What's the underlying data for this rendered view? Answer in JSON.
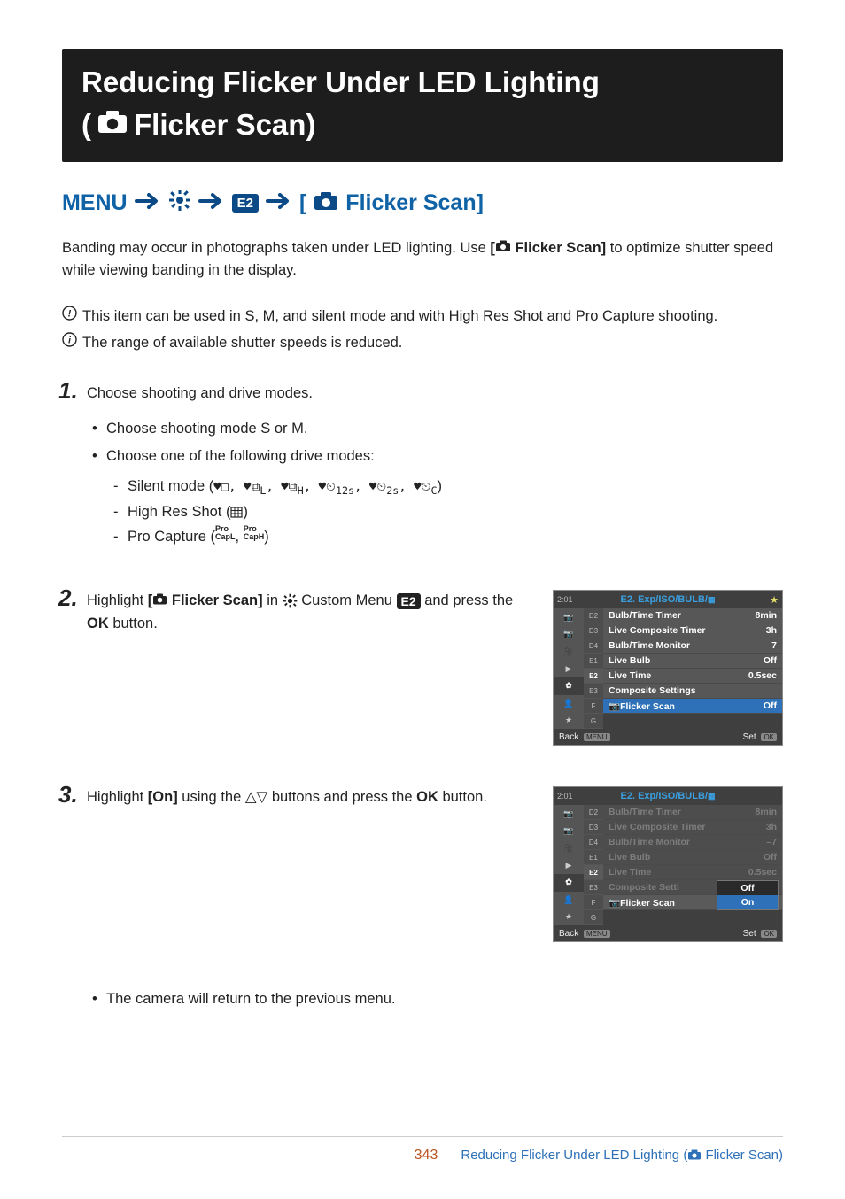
{
  "title": {
    "line1": "Reducing Flicker Under LED Lighting",
    "line2a": "(",
    "line2b": " Flicker Scan)"
  },
  "breadcrumb": {
    "menu": "MENU",
    "e2": "E2",
    "tail": " Flicker Scan]"
  },
  "intro": {
    "p1a": "Banding may occur in photographs taken under LED lighting. Use ",
    "p1b": "[",
    "p1c": " Flicker Scan]",
    "p1d": " to optimize shutter speed while viewing banding in the display."
  },
  "notes": {
    "n1a": "This item can be used in ",
    "n1S": "S",
    "n1comma": ", ",
    "n1M": "M",
    "n1b": ", and silent mode and with High Res Shot and Pro Capture shooting.",
    "n2": "The range of available shutter speeds is reduced."
  },
  "steps": {
    "s1": {
      "text": "Choose shooting and drive modes.",
      "a_pre": "Choose shooting mode ",
      "a_S": "S",
      "a_or": " or ",
      "a_M": "M",
      "a_post": ".",
      "b": "Choose one of the following drive modes:",
      "d1": "Silent mode (",
      "d1_end": ")",
      "d2": "High Res Shot (",
      "d2_end": ")",
      "d3": "Pro Capture (",
      "d3_end": ")",
      "pro_l": "Pro",
      "cap_l": "CapL",
      "cap_h": "CapH"
    },
    "s2": {
      "a": "Highlight ",
      "b": "[",
      "c": " Flicker Scan]",
      "d": " in ",
      "e": " Custom Menu ",
      "f": " and press the ",
      "g": "OK",
      "h": " button."
    },
    "s3": {
      "a": "Highlight ",
      "b": "[On]",
      "c": " using the ",
      "d": " buttons and press the ",
      "e": "OK",
      "f": " button.",
      "note": "The camera will return to the previous menu."
    }
  },
  "menuA": {
    "headL": "2:01",
    "headC": "E2. Exp/ISO/BULB/",
    "tabs": [
      "D2",
      "D3",
      "D4",
      "E1",
      "E2",
      "E3",
      "F",
      "G"
    ],
    "leftIcons": [
      "📷",
      "📷",
      "🎥",
      "▶",
      "✿",
      "👤",
      "★"
    ],
    "rows": [
      {
        "label": "Bulb/Time Timer",
        "val": "8min"
      },
      {
        "label": "Live Composite Timer",
        "val": "3h"
      },
      {
        "label": "Bulb/Time Monitor",
        "val": "–7"
      },
      {
        "label": "Live Bulb",
        "val": "Off"
      },
      {
        "label": "Live Time",
        "val": "0.5sec"
      },
      {
        "label": "Composite Settings",
        "val": ""
      },
      {
        "label": "Flicker Scan",
        "val": "Off",
        "cam": true
      }
    ],
    "footL": "Back",
    "footLTag": "MENU",
    "footR": "Set",
    "footRTag": "OK"
  },
  "menuB": {
    "headC": "E2. Exp/ISO/BULB/",
    "popup": {
      "off": "Off",
      "on": "On"
    }
  },
  "footer": {
    "page": "343",
    "link_a": "Reducing Flicker Under LED Lighting (",
    "link_b": " Flicker Scan)"
  }
}
